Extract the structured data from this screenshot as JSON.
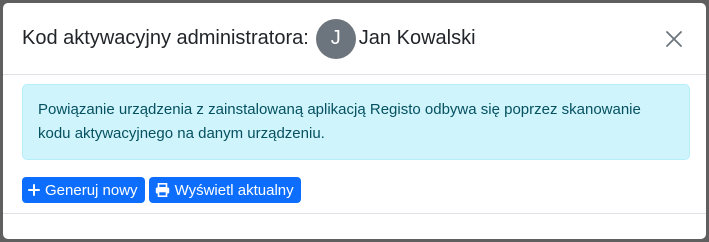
{
  "modal": {
    "title": "Kod aktywacyjny administratora:",
    "user": {
      "initial": "J",
      "name": "Jan Kowalski"
    },
    "close_icon": "close-icon"
  },
  "alert": {
    "text": "Powiązanie urządzenia z zainstalowaną aplikacją Registo odbywa się poprzez skanowanie kodu aktywacyjnego na danym urządzeniu."
  },
  "actions": {
    "generate_label": "Generuj nowy",
    "generate_icon": "plus-icon",
    "show_label": "Wyświetl aktualny",
    "show_icon": "printer-icon"
  },
  "colors": {
    "primary": "#0d6efd",
    "alert_bg": "#cff4fc",
    "alert_text": "#055160",
    "avatar_bg": "#6c757d"
  }
}
